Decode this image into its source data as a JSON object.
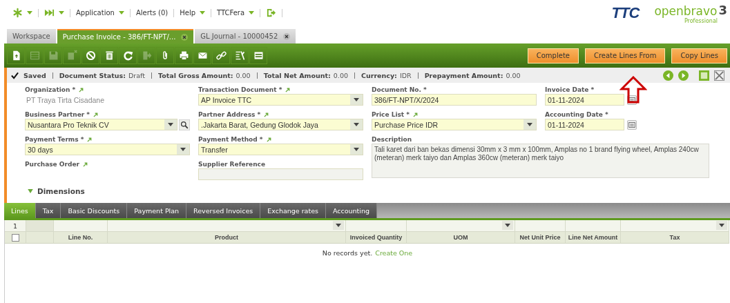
{
  "nav": [
    {
      "kind": "icon-menu"
    },
    {
      "kind": "icon-menu"
    },
    {
      "kind": "menu",
      "label": "Application"
    },
    {
      "kind": "link",
      "label": "Alerts (0)"
    },
    {
      "kind": "menu",
      "label": "Help"
    },
    {
      "kind": "menu",
      "label": "TTCFera"
    },
    {
      "kind": "icon"
    }
  ],
  "logos": {
    "company": "TTC",
    "product": "openbravo",
    "edition": "Professional",
    "version": "3"
  },
  "window_tabs": [
    {
      "label": "Workspace",
      "selected": false,
      "closable": false
    },
    {
      "label": "Purchase Invoice - 386/FT-NPT/...",
      "selected": true,
      "closable": true
    },
    {
      "label": "GL Journal - 10000452",
      "selected": false,
      "closable": true
    }
  ],
  "toolbar": {
    "icons": [
      {
        "disabled": false
      },
      {
        "disabled": true
      },
      {
        "disabled": true
      },
      {
        "disabled": true
      },
      {
        "disabled": false
      },
      {
        "disabled": false
      },
      {
        "disabled": false
      },
      {
        "disabled": true
      },
      {
        "disabled": false
      },
      {
        "disabled": false
      },
      {
        "disabled": false
      },
      {
        "disabled": false
      },
      {
        "disabled": false
      },
      {
        "disabled": false
      }
    ],
    "actions": [
      "Complete",
      "Create Lines From",
      "Copy Lines"
    ]
  },
  "status_bar": {
    "saved": "Saved",
    "items": [
      {
        "label": "Document Status:",
        "value": "Draft"
      },
      {
        "label": "Total Gross Amount:",
        "value": "0.00"
      },
      {
        "label": "Total Net Amount:",
        "value": "0.00"
      },
      {
        "label": "Currency:",
        "value": "IDR"
      },
      {
        "label": "Prepayment Amount:",
        "value": "0.00"
      }
    ]
  },
  "form": {
    "fields": [
      {
        "label": "Organization *",
        "link": true,
        "kind": "readonly",
        "value": "PT Traya Tirta Cisadane"
      },
      {
        "label": "Transaction Document *",
        "link": true,
        "kind": "select",
        "value": "AP Invoice TTC"
      },
      {
        "label": "Document No. *",
        "link": false,
        "kind": "text",
        "value": "386/FT-NPT/X/2024"
      },
      {
        "label": "Invoice Date *",
        "link": false,
        "kind": "date",
        "value": "01-11-2024"
      },
      {
        "label": "Business Partner *",
        "link": true,
        "kind": "lookup",
        "value": "Nusantara Pro Teknik CV"
      },
      {
        "label": "Partner Address *",
        "link": true,
        "kind": "select",
        "value": ".Jakarta Barat, Gedung Glodok Jaya"
      },
      {
        "label": "Price List *",
        "link": true,
        "kind": "select",
        "value": "Purchase Price IDR"
      },
      {
        "label": "Accounting Date *",
        "link": false,
        "kind": "date",
        "value": "01-11-2024"
      },
      {
        "label": "Payment Terms *",
        "link": true,
        "kind": "select",
        "value": "30 days"
      },
      {
        "label": "Payment Method *",
        "link": true,
        "kind": "select",
        "value": "Transfer"
      },
      {
        "label": "Description",
        "link": false,
        "kind": "textarea",
        "value": "Tali karet dari ban bekas dimensi 30mm x 3 mm x 100mm, Amplas no 1 brand flying wheel, Amplas 240cw (meteran) merk taiyo dan Amplas 360cw (meteran) merk taiyo"
      },
      {
        "label": "Purchase Order",
        "link": true,
        "kind": "none"
      },
      {
        "label": "Supplier Reference",
        "link": false,
        "kind": "empty"
      }
    ],
    "section": "Dimensions"
  },
  "sub_tabs": [
    {
      "label": "Lines",
      "selected": true
    },
    {
      "label": "Tax",
      "selected": false
    },
    {
      "label": "Basic Discounts",
      "selected": false
    },
    {
      "label": "Payment Plan",
      "selected": false
    },
    {
      "label": "Reversed Invoices",
      "selected": false
    },
    {
      "label": "Exchange rates",
      "selected": false
    },
    {
      "label": "Accounting",
      "selected": false
    }
  ],
  "grid": {
    "row_count": "1",
    "select_all_checked": false,
    "columns": [
      {
        "label": "Line No.",
        "dropdown": false
      },
      {
        "label": "Product",
        "dropdown": true
      },
      {
        "label": "Invoiced Quantity",
        "dropdown": false
      },
      {
        "label": "UOM",
        "dropdown": true
      },
      {
        "label": "Net Unit Price",
        "dropdown": false
      },
      {
        "label": "Line Net Amount",
        "dropdown": false
      },
      {
        "label": "Tax",
        "dropdown": true
      }
    ],
    "empty_text": "No records yet.",
    "empty_link": "Create One"
  }
}
